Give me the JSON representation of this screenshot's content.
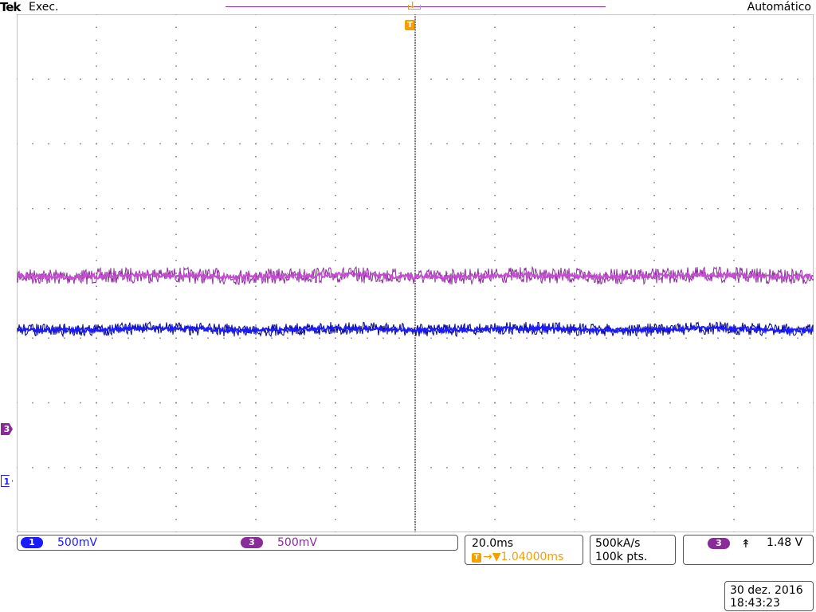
{
  "header": {
    "brand": "Tek",
    "run_status": "Exec.",
    "acquisition_mode": "Automático"
  },
  "markers": {
    "trigger": "T",
    "channel3": "3",
    "channel1": "1"
  },
  "channels": [
    {
      "number": "1",
      "scale": "500mV",
      "color": "#1a1aff"
    },
    {
      "number": "3",
      "scale": "500mV",
      "color": "#8a2b9a"
    }
  ],
  "timebase": {
    "scale": "20.0ms",
    "trigger_delay": "1.04000ms"
  },
  "acquisition": {
    "sample_rate": "500kA/s",
    "record_length": "100k pts."
  },
  "trigger": {
    "source": "3",
    "slope_icon": "rising-edge-icon",
    "level": "1.48 V"
  },
  "timestamp": {
    "date": "30 dez. 2016",
    "time": "18:43:23"
  },
  "colors": {
    "trigger": "#f3a000",
    "ch1": "#1a1aff",
    "ch3": "#8a2b9a",
    "grid": "#777777"
  }
}
